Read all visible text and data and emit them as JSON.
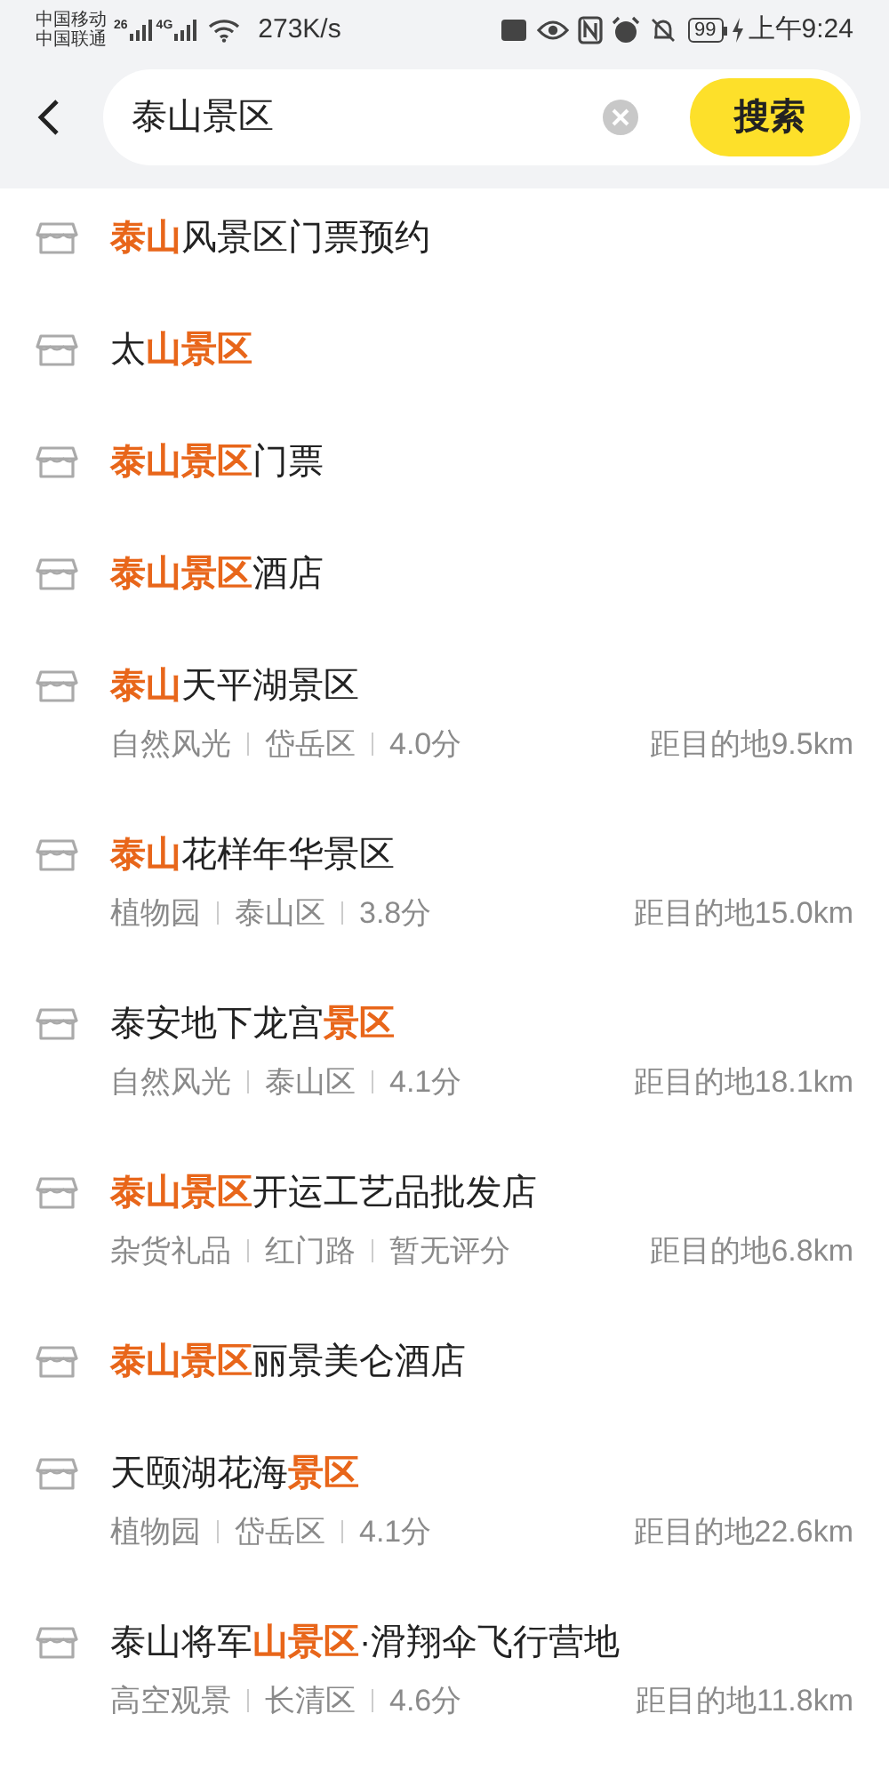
{
  "status_bar": {
    "carriers": [
      "中国移动",
      "中国联通"
    ],
    "network_labels": [
      "26",
      "4G"
    ],
    "speed": "273K/s",
    "battery": "99",
    "time": "上午9:24"
  },
  "search": {
    "value": "泰山景区",
    "button": "搜索"
  },
  "results": [
    {
      "title": "**泰山**风景区门票预约"
    },
    {
      "title": "太**山景区**"
    },
    {
      "title": "**泰山景区**门票"
    },
    {
      "title": "**泰山景区**酒店"
    },
    {
      "title": "**泰山**天平湖景区",
      "category": "自然风光",
      "district": "岱岳区",
      "rating": "4.0分",
      "distance": "距目的地9.5km"
    },
    {
      "title": "**泰山**花样年华景区",
      "category": "植物园",
      "district": "泰山区",
      "rating": "3.8分",
      "distance": "距目的地15.0km"
    },
    {
      "title": "泰安地下龙宫**景区**",
      "category": "自然风光",
      "district": "泰山区",
      "rating": "4.1分",
      "distance": "距目的地18.1km"
    },
    {
      "title": "**泰山景区**开运工艺品批发店",
      "category": "杂货礼品",
      "district": "红门路",
      "rating": "暂无评分",
      "distance": "距目的地6.8km"
    },
    {
      "title": "**泰山景区**丽景美仑酒店"
    },
    {
      "title": "天颐湖花海**景区**",
      "category": "植物园",
      "district": "岱岳区",
      "rating": "4.1分",
      "distance": "距目的地22.6km"
    },
    {
      "title": "泰山将军**山景区**·滑翔伞飞行营地",
      "category": "高空观景",
      "district": "长清区",
      "rating": "4.6分",
      "distance": "距目的地11.8km"
    }
  ]
}
